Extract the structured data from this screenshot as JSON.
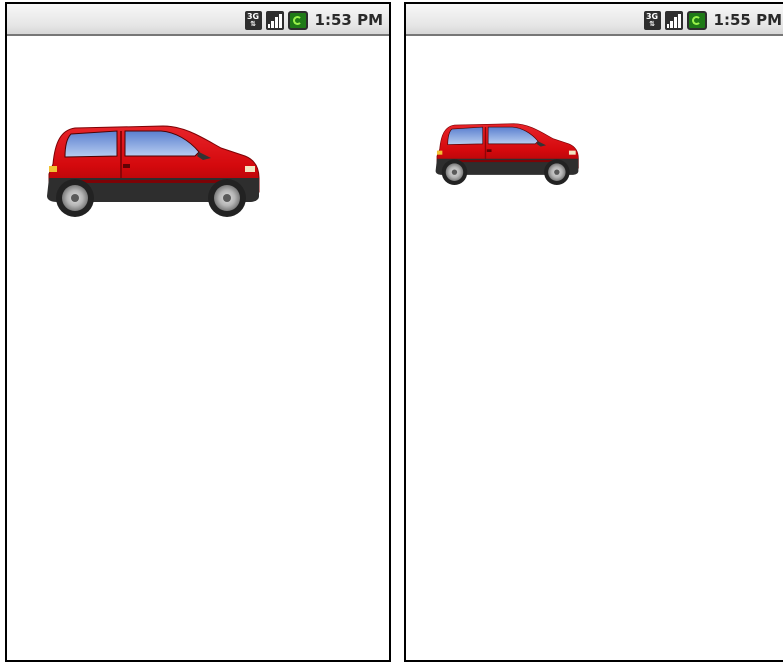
{
  "screens": [
    {
      "id": "left",
      "status_bar": {
        "network_label": "3G",
        "network_icon": "3g-data-icon",
        "signal_icon": "signal-strength-icon",
        "battery_icon": "battery-charging-icon",
        "time": "1:53 PM"
      },
      "content": {
        "image": "red-car-icon",
        "scale": "large"
      }
    },
    {
      "id": "right",
      "status_bar": {
        "network_label": "3G",
        "network_icon": "3g-data-icon",
        "signal_icon": "signal-strength-icon",
        "battery_icon": "battery-charging-icon",
        "time": "1:55 PM"
      },
      "content": {
        "image": "red-car-icon",
        "scale": "small"
      }
    }
  ],
  "colors": {
    "car_body": "#d4090d",
    "window": "#7f9fda",
    "battery": "#1f7a17",
    "status_bar": "#e8e8e8"
  }
}
